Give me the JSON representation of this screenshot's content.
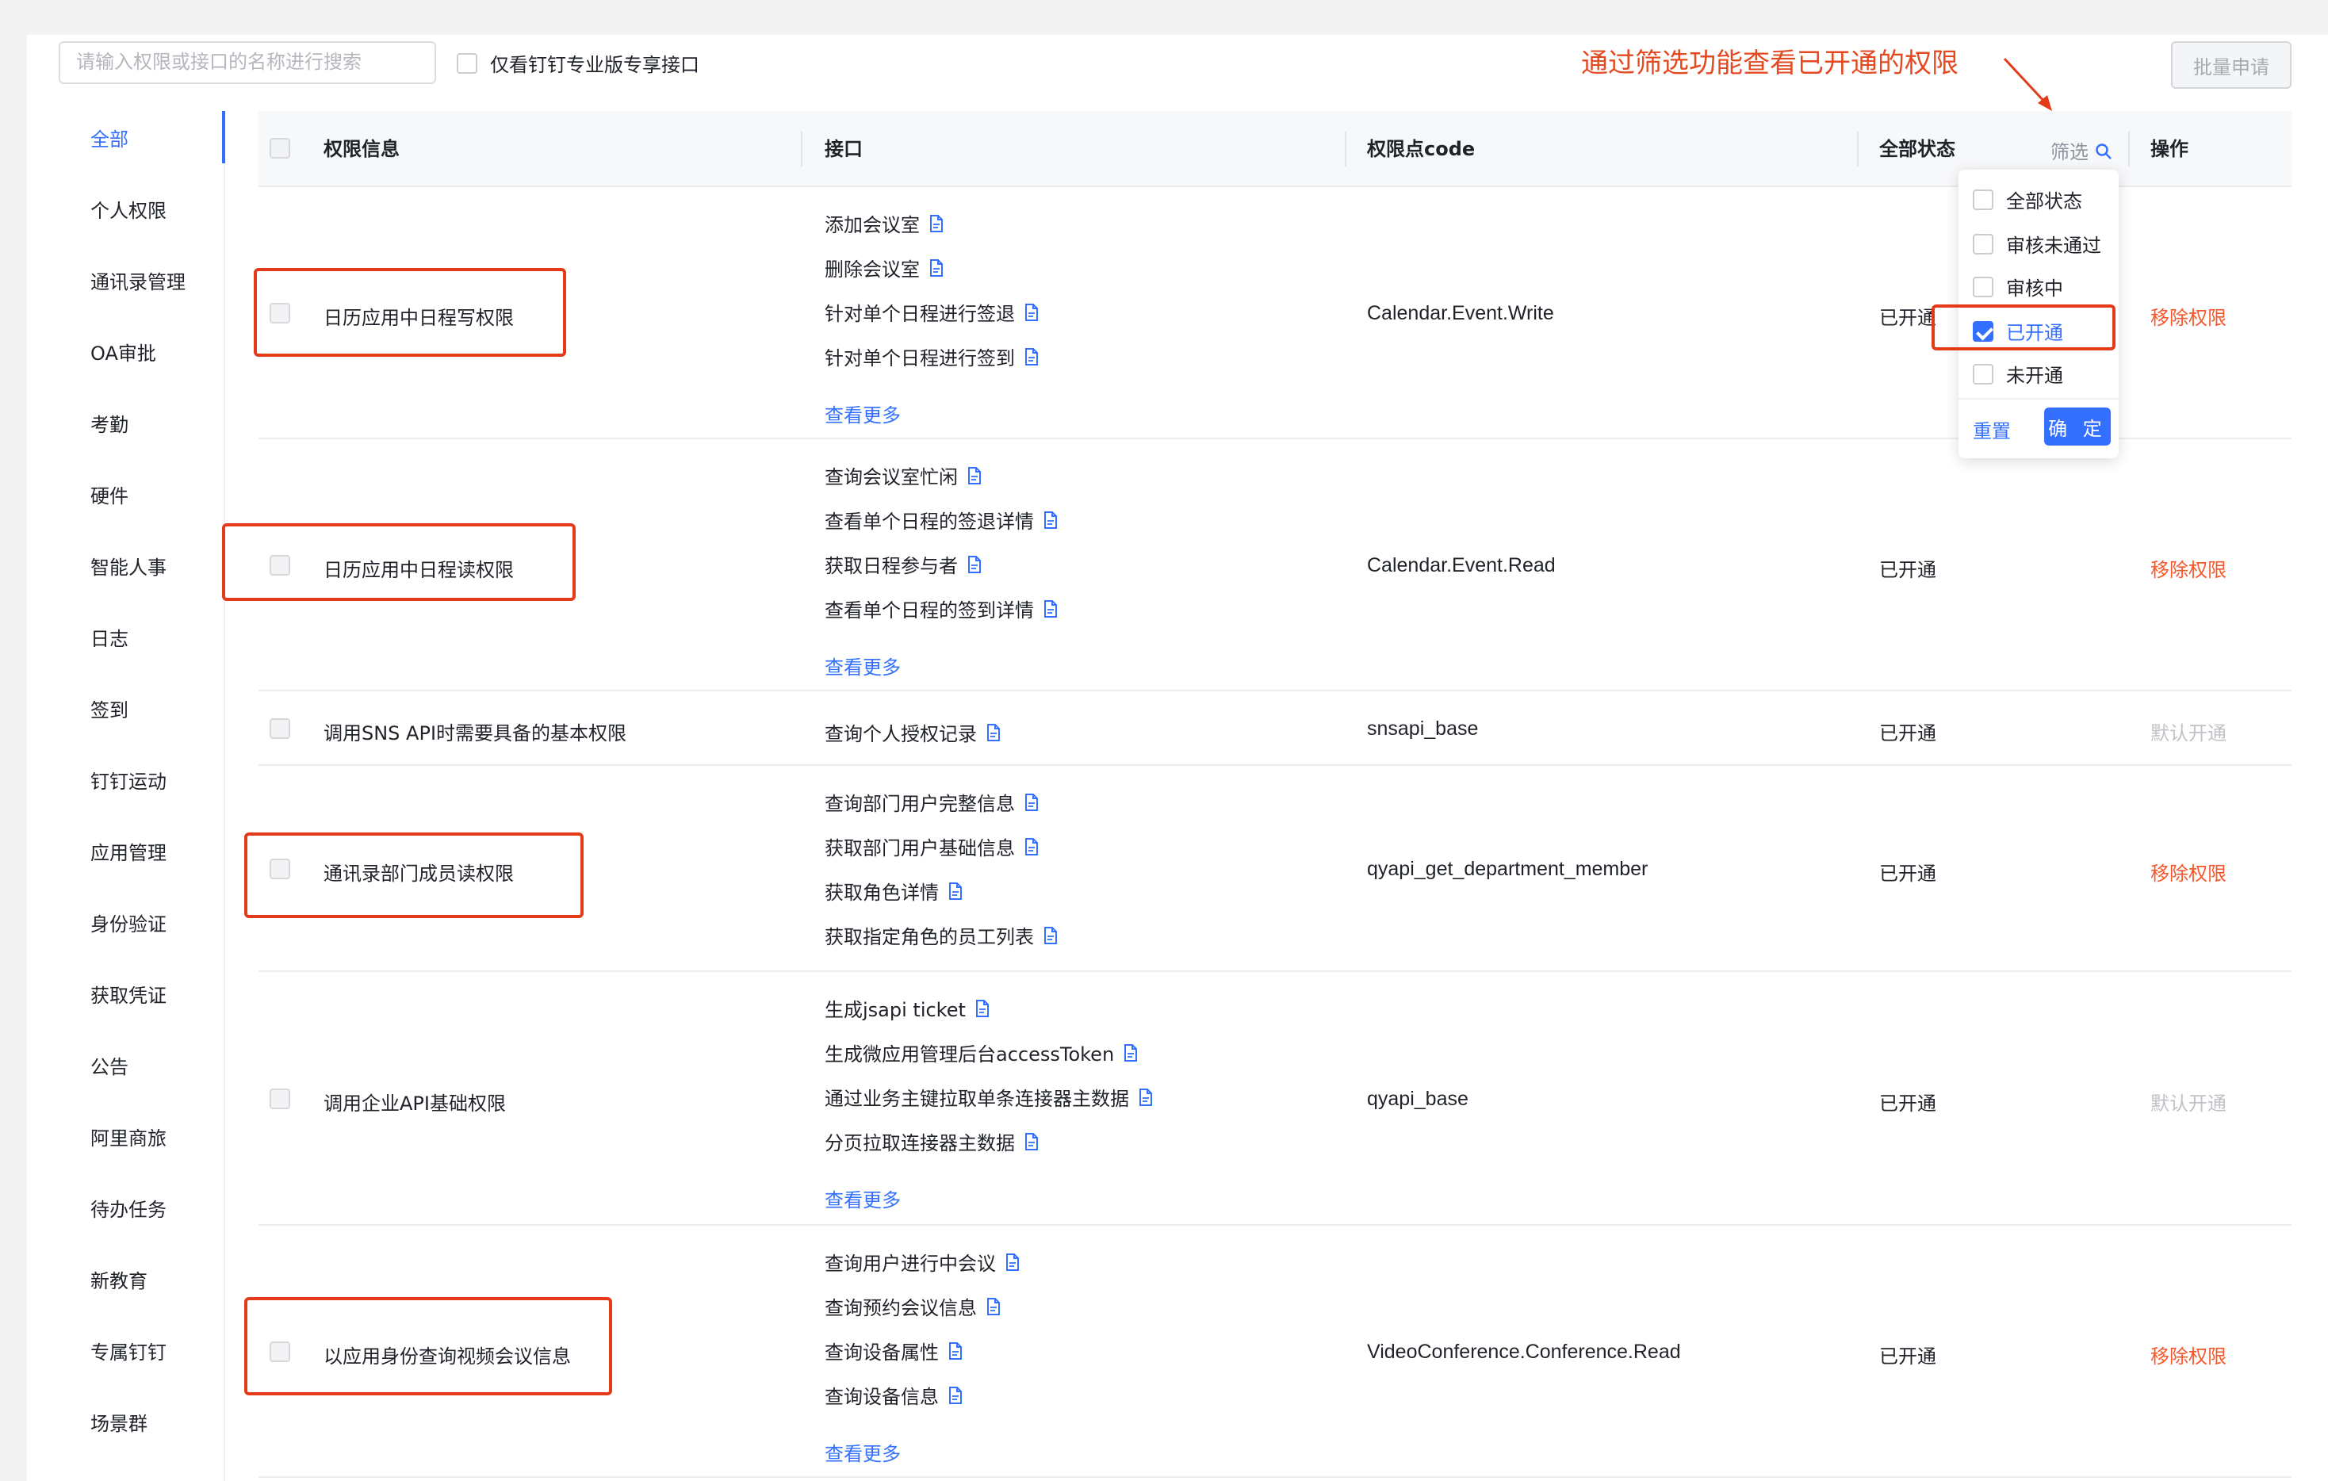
{
  "toolbar": {
    "search_placeholder": "请输入权限或接口的名称进行搜索",
    "only_pro_label": "仅看钉钉专业版专享接口",
    "batch_apply_label": "批量申请"
  },
  "annotation": "通过筛选功能查看已开通的权限",
  "sidebar": {
    "items": [
      {
        "label": "全部",
        "active": true
      },
      {
        "label": "个人权限"
      },
      {
        "label": "通讯录管理"
      },
      {
        "label": "OA审批"
      },
      {
        "label": "考勤"
      },
      {
        "label": "硬件"
      },
      {
        "label": "智能人事"
      },
      {
        "label": "日志"
      },
      {
        "label": "签到"
      },
      {
        "label": "钉钉运动"
      },
      {
        "label": "应用管理"
      },
      {
        "label": "身份验证"
      },
      {
        "label": "获取凭证"
      },
      {
        "label": "公告"
      },
      {
        "label": "阿里商旅"
      },
      {
        "label": "待办任务"
      },
      {
        "label": "新教育"
      },
      {
        "label": "专属钉钉"
      },
      {
        "label": "场景群"
      }
    ]
  },
  "table": {
    "headers": {
      "info": "权限信息",
      "api": "接口",
      "code": "权限点code",
      "status": "全部状态",
      "filter": "筛选",
      "action": "操作"
    },
    "rows": [
      {
        "name": "日历应用中日程写权限",
        "apis": [
          "添加会议室",
          "删除会议室",
          "针对单个日程进行签退",
          "针对单个日程进行签到"
        ],
        "more": "查看更多",
        "code": "Calendar.Event.Write",
        "status": "已开通",
        "action": "移除权限",
        "highlighted": true
      },
      {
        "name": "日历应用中日程读权限",
        "apis": [
          "查询会议室忙闲",
          "查看单个日程的签退详情",
          "获取日程参与者",
          "查看单个日程的签到详情"
        ],
        "more": "查看更多",
        "code": "Calendar.Event.Read",
        "status": "已开通",
        "action": "移除权限",
        "highlighted": true
      },
      {
        "name": "调用SNS API时需要具备的基本权限",
        "apis": [
          "查询个人授权记录"
        ],
        "code": "snsapi_base",
        "status": "已开通",
        "action": "默认开通",
        "highlighted": false
      },
      {
        "name": "通讯录部门成员读权限",
        "apis": [
          "查询部门用户完整信息",
          "获取部门用户基础信息",
          "获取角色详情",
          "获取指定角色的员工列表"
        ],
        "code": "qyapi_get_department_member",
        "status": "已开通",
        "action": "移除权限",
        "highlighted": true
      },
      {
        "name": "调用企业API基础权限",
        "apis": [
          "生成jsapi ticket",
          "生成微应用管理后台accessToken",
          "通过业务主键拉取单条连接器主数据",
          "分页拉取连接器主数据"
        ],
        "more": "查看更多",
        "code": "qyapi_base",
        "status": "已开通",
        "action": "默认开通",
        "highlighted": false
      },
      {
        "name": "以应用身份查询视频会议信息",
        "apis": [
          "查询用户进行中会议",
          "查询预约会议信息",
          "查询设备属性",
          "查询设备信息"
        ],
        "more": "查看更多",
        "code": "VideoConference.Conference.Read",
        "status": "已开通",
        "action": "移除权限",
        "highlighted": true
      }
    ]
  },
  "filter_dropdown": {
    "options": [
      {
        "label": "全部状态",
        "checked": false
      },
      {
        "label": "审核未通过",
        "checked": false
      },
      {
        "label": "审核中",
        "checked": false
      },
      {
        "label": "已开通",
        "checked": true
      },
      {
        "label": "未开通",
        "checked": false
      }
    ],
    "reset_label": "重置",
    "confirm_label": "确 定"
  },
  "colors": {
    "primary": "#3370ff",
    "danger": "#f5572a",
    "annotation": "#e33b1a",
    "muted": "#bfc2c7"
  }
}
